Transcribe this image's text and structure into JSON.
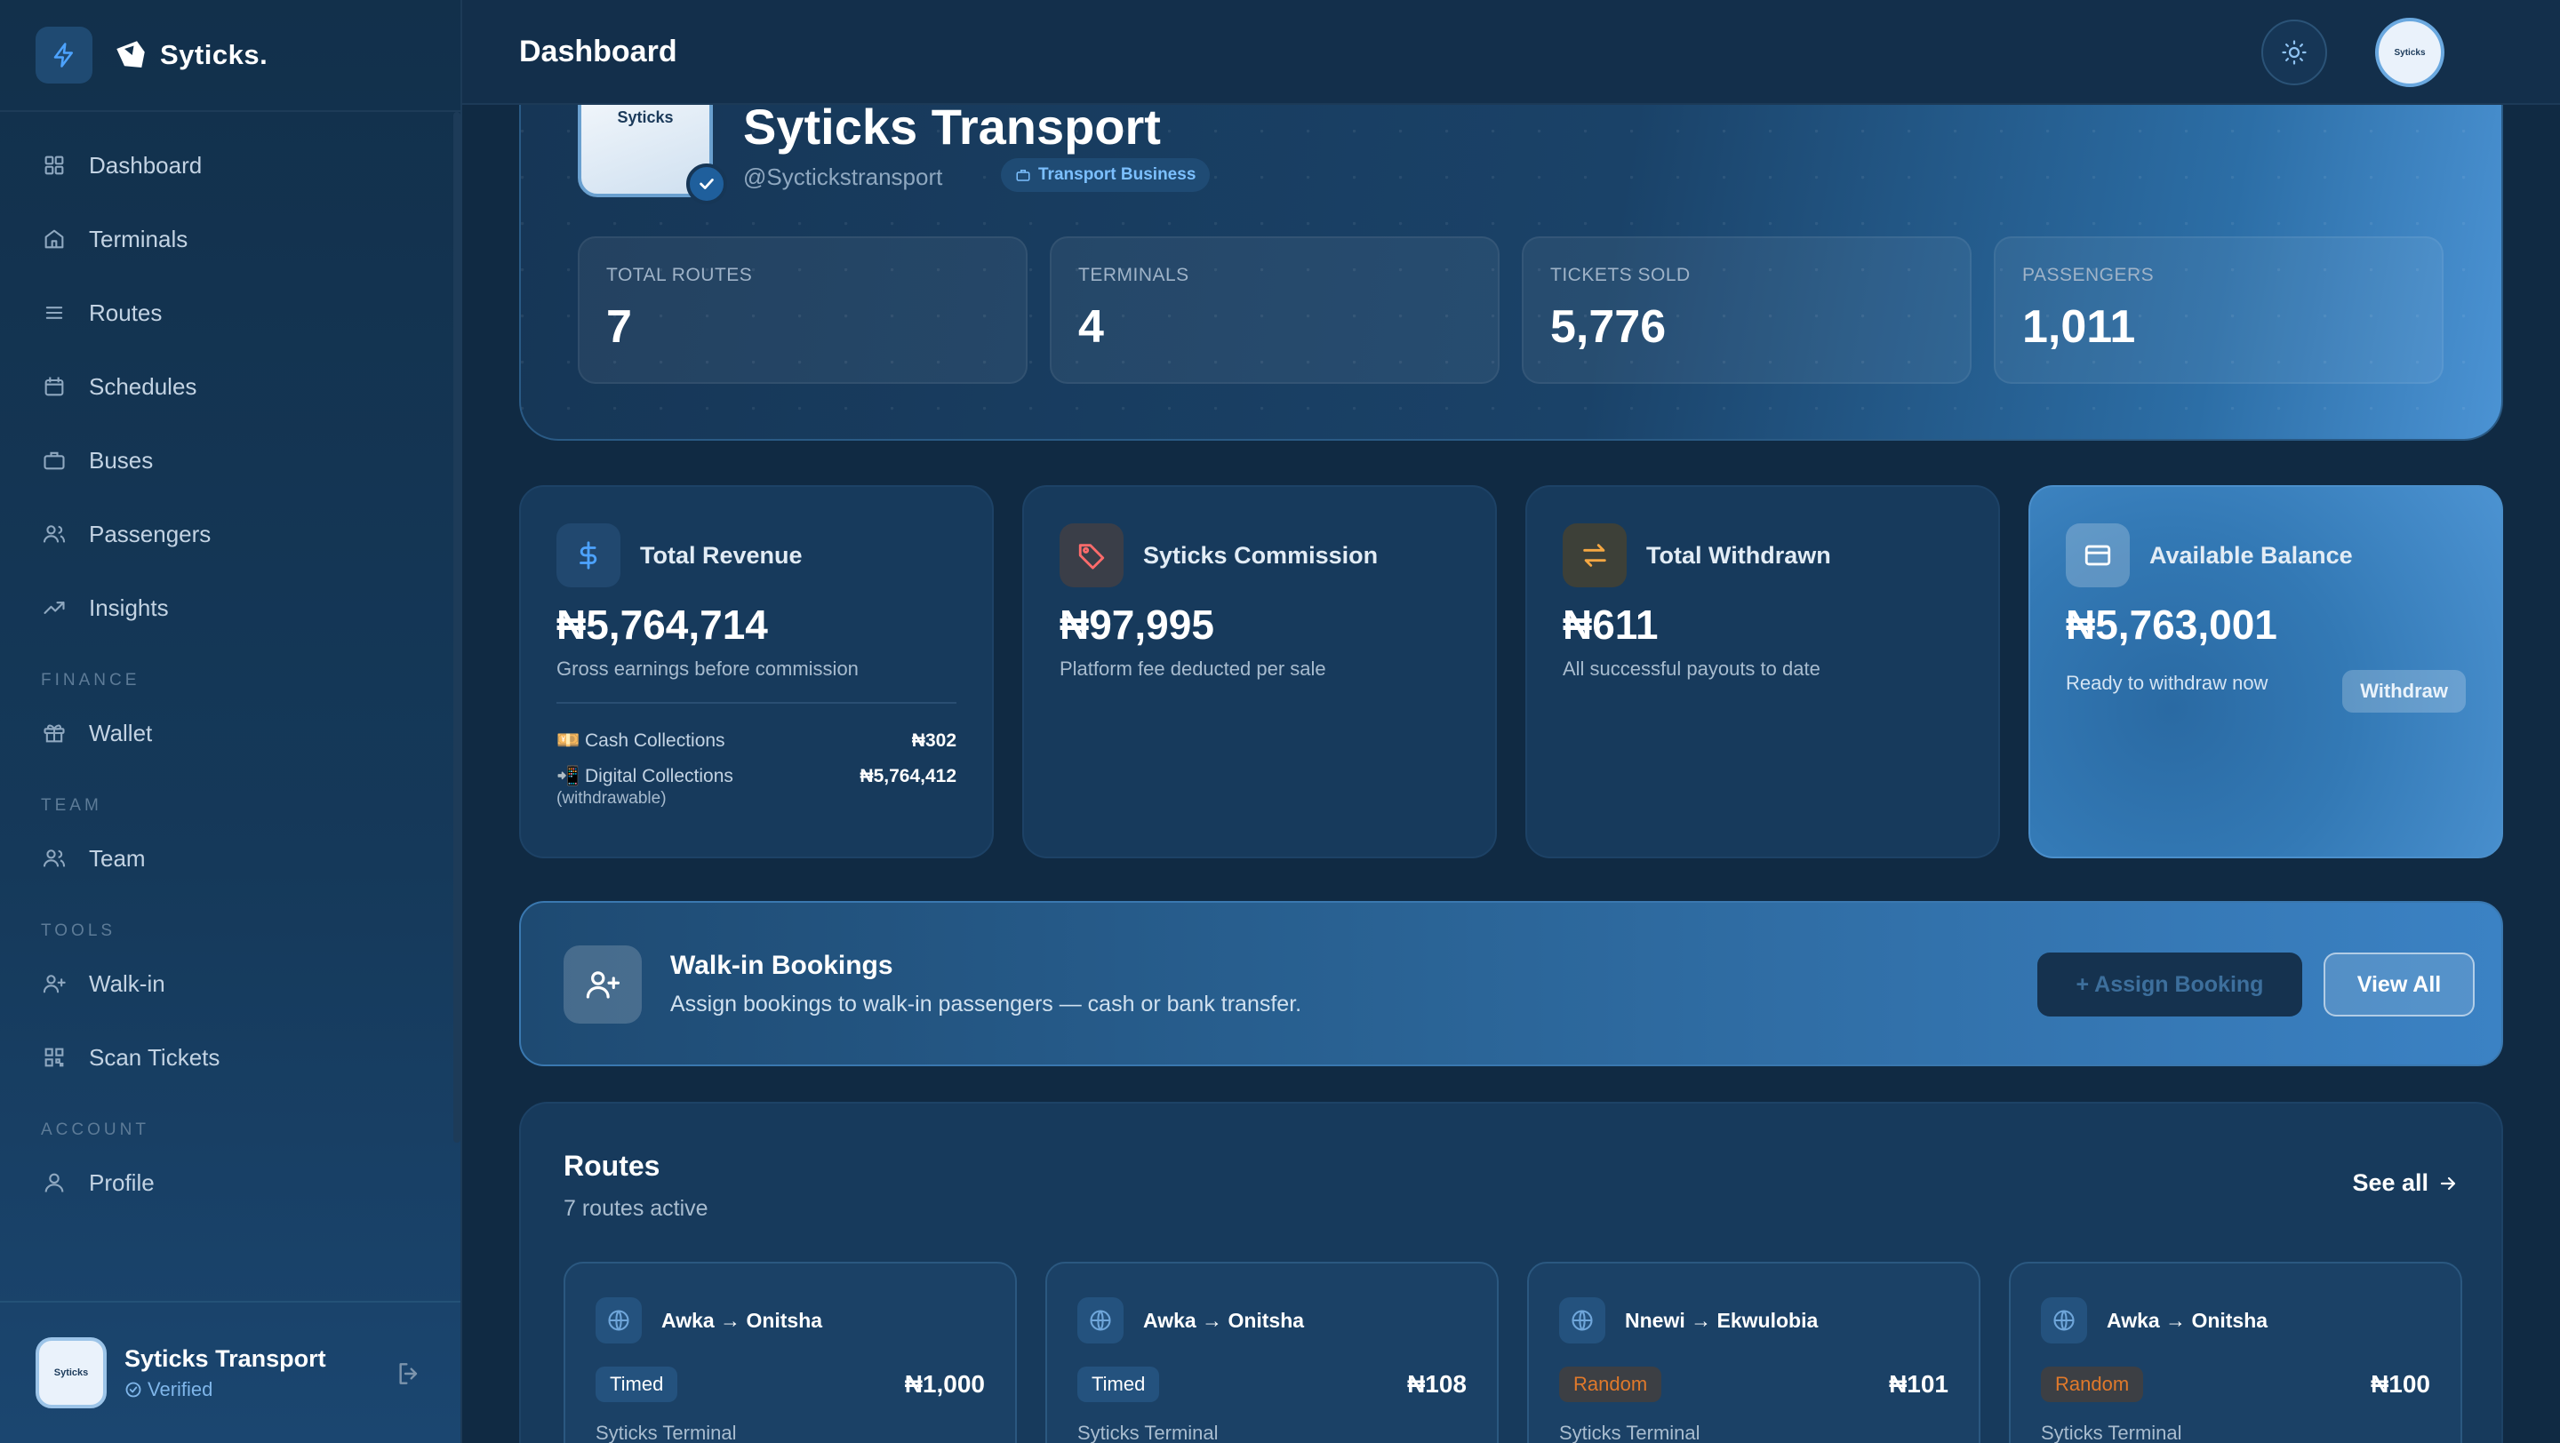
{
  "brand": {
    "name": "Syticks."
  },
  "sidebar": {
    "items": [
      {
        "label": "Dashboard",
        "icon": "grid-icon"
      },
      {
        "label": "Terminals",
        "icon": "home-icon"
      },
      {
        "label": "Routes",
        "icon": "list-icon"
      },
      {
        "label": "Schedules",
        "icon": "calendar-icon"
      },
      {
        "label": "Buses",
        "icon": "briefcase-icon"
      },
      {
        "label": "Passengers",
        "icon": "users-icon"
      },
      {
        "label": "Insights",
        "icon": "trending-up-icon"
      }
    ],
    "finance_label": "FINANCE",
    "finance_items": [
      {
        "label": "Wallet",
        "icon": "gift-icon"
      }
    ],
    "team_label": "TEAM",
    "team_items": [
      {
        "label": "Team",
        "icon": "users-icon"
      }
    ],
    "tools_label": "TOOLS",
    "tools_items": [
      {
        "label": "Walk-in",
        "icon": "user-plus-icon"
      },
      {
        "label": "Scan Tickets",
        "icon": "qr-icon"
      }
    ],
    "account_label": "ACCOUNT",
    "account_items": [
      {
        "label": "Profile",
        "icon": "user-icon"
      }
    ],
    "footer": {
      "name": "Syticks Transport",
      "status": "Verified",
      "avatar_text": "Syticks"
    }
  },
  "topbar": {
    "title": "Dashboard",
    "avatar_text": "Syticks"
  },
  "hero": {
    "logo_text": "Syticks",
    "name": "Syticks Transport",
    "handle": "@Syctickstransport",
    "badge": "Transport Business",
    "stats": [
      {
        "label": "TOTAL ROUTES",
        "value": "7"
      },
      {
        "label": "TERMINALS",
        "value": "4"
      },
      {
        "label": "TICKETS SOLD",
        "value": "5,776"
      },
      {
        "label": "PASSENGERS",
        "value": "1,011"
      }
    ]
  },
  "cards": {
    "revenue": {
      "title": "Total Revenue",
      "value": "₦5,764,714",
      "sub": "Gross earnings before commission",
      "cash_label": "💴 Cash Collections",
      "cash_amount": "₦302",
      "digital_label": "📲 Digital Collections",
      "digital_amount": "₦5,764,412",
      "digital_note": "(withdrawable)"
    },
    "commission": {
      "title": "Syticks Commission",
      "value": "₦97,995",
      "sub": "Platform fee deducted per sale"
    },
    "withdrawn": {
      "title": "Total Withdrawn",
      "value": "₦611",
      "sub": "All successful payouts to date"
    },
    "balance": {
      "title": "Available Balance",
      "value": "₦5,763,001",
      "sub": "Ready to withdraw now",
      "button": "Withdraw"
    }
  },
  "walkin": {
    "title": "Walk-in Bookings",
    "sub": "Assign bookings to walk-in passengers — cash or bank transfer.",
    "assign_button": "+ Assign Booking",
    "view_all_button": "View All"
  },
  "routes": {
    "title": "Routes",
    "sub": "7 routes active",
    "see_all": "See all",
    "items": [
      {
        "name": "Awka → Onitsha",
        "type": "Timed",
        "price": "₦1,000",
        "terminal": "Syticks Terminal"
      },
      {
        "name": "Awka → Onitsha",
        "type": "Timed",
        "price": "₦108",
        "terminal": "Syticks Terminal"
      },
      {
        "name": "Nnewi → Ekwulobia",
        "type": "Random",
        "price": "₦101",
        "terminal": "Syticks Terminal"
      },
      {
        "name": "Awka → Onitsha",
        "type": "Random",
        "price": "₦100",
        "terminal": "Syticks Terminal"
      }
    ]
  },
  "colors": {
    "background": "#102a43",
    "accent": "#3b82c4",
    "revenue_icon": "#4da3ff",
    "commission_icon": "#ff6b6b",
    "withdrawn_icon": "#f5a742",
    "random_tag": "#e0792b"
  }
}
